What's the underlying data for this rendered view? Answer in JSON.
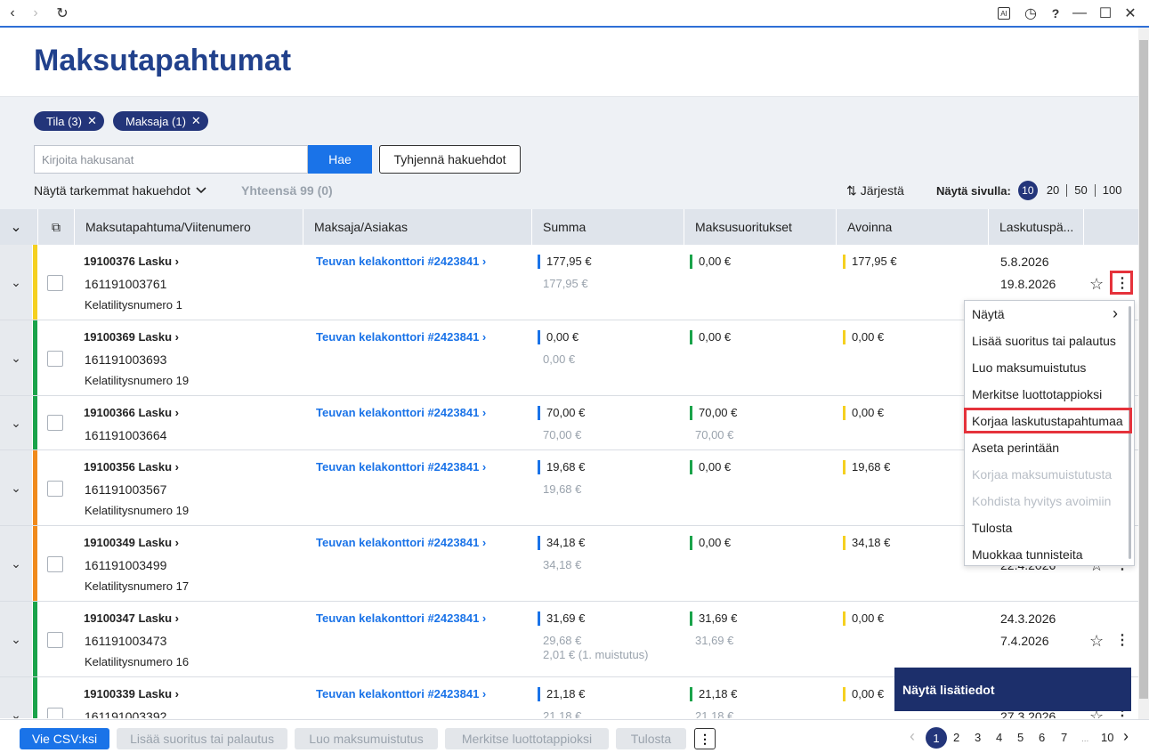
{
  "browser": {
    "back_icon": "‹",
    "forward_icon": "›",
    "reload_icon": "↻",
    "ai_icon": "AI",
    "history_icon": "◷",
    "help_icon": "?",
    "minimize_icon": "—",
    "maximize_icon": "☐",
    "close_icon": "✕"
  },
  "page": {
    "title": "Maksutapahtumat"
  },
  "filters": {
    "chips": [
      {
        "label": "Tila (3)"
      },
      {
        "label": "Maksaja (1)"
      }
    ],
    "chip_close": "✕",
    "search_placeholder": "Kirjoita hakusanat",
    "search_button": "Hae",
    "clear_button": "Tyhjennä hakuehdot",
    "more_filters": "Näytä tarkemmat hakuehdot",
    "total": "Yhteensä 99 (0)",
    "sort": "Järjestä",
    "sort_icon": "⇅",
    "per_page_label": "Näytä sivulla:",
    "per_page_options": [
      "10",
      "20",
      "50",
      "100"
    ]
  },
  "table": {
    "headers": [
      "Maksutapahtuma/Viitenumero",
      "Maksaja/Asiakas",
      "Summa",
      "Maksusuoritukset",
      "Avoinna",
      "Laskutuspä..."
    ],
    "collapse_icon": "⌄",
    "select_all_icon": "⧉",
    "rows": [
      {
        "id": "19100376 Lasku",
        "ref": "161191003761",
        "kela": "Kelatilitysnumero 1",
        "payer": "Teuvan kelakonttori #2423841",
        "summa": "177,95 €",
        "summa2": "177,95 €",
        "suoritus": "0,00 €",
        "suoritus2": "",
        "avoinna": "177,95 €",
        "date1": "5.8.2026",
        "date2": "19.8.2026",
        "status": "#f5d020"
      },
      {
        "id": "19100369 Lasku",
        "ref": "161191003693",
        "kela": "Kelatilitysnumero 19",
        "payer": "Teuvan kelakonttori #2423841",
        "summa": "0,00 €",
        "summa2": "0,00 €",
        "suoritus": "0,00 €",
        "suoritus2": "",
        "avoinna": "0,00 €",
        "date1": "",
        "date2": "",
        "status": "#1aa34a"
      },
      {
        "id": "19100366 Lasku",
        "ref": "161191003664",
        "kela": "",
        "payer": "Teuvan kelakonttori #2423841",
        "summa": "70,00 €",
        "summa2": "70,00 €",
        "suoritus": "70,00 €",
        "suoritus2": "70,00 €",
        "avoinna": "0,00 €",
        "date1": "",
        "date2": "",
        "status": "#1aa34a"
      },
      {
        "id": "19100356 Lasku",
        "ref": "161191003567",
        "kela": "Kelatilitysnumero 19",
        "payer": "Teuvan kelakonttori #2423841",
        "summa": "19,68 €",
        "summa2": "19,68 €",
        "suoritus": "0,00 €",
        "suoritus2": "",
        "avoinna": "19,68 €",
        "date1": "",
        "date2": "",
        "status": "#f08a1c"
      },
      {
        "id": "19100349 Lasku",
        "ref": "161191003499",
        "kela": "Kelatilitysnumero 17",
        "payer": "Teuvan kelakonttori #2423841",
        "summa": "34,18 €",
        "summa2": "34,18 €",
        "suoritus": "0,00 €",
        "suoritus2": "",
        "avoinna": "34,18 €",
        "date1": "",
        "date2": "22.4.2026",
        "status": "#f08a1c"
      },
      {
        "id": "19100347 Lasku",
        "ref": "161191003473",
        "kela": "Kelatilitysnumero 16",
        "payer": "Teuvan kelakonttori #2423841",
        "summa": "31,69 €",
        "summa2": "29,68 €",
        "summa3": "2,01 € (1. muistutus)",
        "suoritus": "31,69 €",
        "suoritus2": "31,69 €",
        "avoinna": "0,00 €",
        "date1": "24.3.2026",
        "date2": "7.4.2026",
        "status": "#1aa34a"
      },
      {
        "id": "19100339 Lasku",
        "ref": "161191003392",
        "kela": "",
        "payer": "Teuvan kelakonttori #2423841",
        "summa": "21,18 €",
        "summa2": "21,18 €",
        "suoritus": "21,18 €",
        "suoritus2": "21,18 €",
        "avoinna": "0,00 €",
        "date1": "",
        "date2": "27.3.2026",
        "status": "#1aa34a"
      }
    ],
    "star_icon": "☆",
    "menu_icon": "⋮",
    "expand_icon": "⌄",
    "link_arrow": "›"
  },
  "context_menu": {
    "items": [
      {
        "label": "Näytä",
        "disabled": false
      },
      {
        "label": "Lisää suoritus tai palautus",
        "disabled": false
      },
      {
        "label": "Luo maksumuistutus",
        "disabled": false
      },
      {
        "label": "Merkitse luottotappioksi",
        "disabled": false
      },
      {
        "label": "Korjaa laskutustapahtumaa",
        "disabled": false
      },
      {
        "label": "Aseta perintään",
        "disabled": false
      },
      {
        "label": "Korjaa maksumuistutusta",
        "disabled": true
      },
      {
        "label": "Kohdista hyvitys avoimiin",
        "disabled": true
      },
      {
        "label": "Tulosta",
        "disabled": false
      },
      {
        "label": "Muokkaa tunnisteita",
        "disabled": false
      }
    ],
    "submenu_icon": "›"
  },
  "more_info": "Näytä lisätiedot",
  "bottom": {
    "csv": "Vie CSV:ksi",
    "actions": [
      "Lisää suoritus tai palautus",
      "Luo maksumuistutus",
      "Merkitse luottotappioksi",
      "Tulosta"
    ],
    "more_icon": "⋮",
    "pages": [
      "1",
      "2",
      "3",
      "4",
      "5",
      "6",
      "7",
      "...",
      "10"
    ],
    "prev_icon": "‹",
    "next_icon": "›"
  },
  "colors": {
    "accent": "#1a73e8",
    "navy": "#23357a",
    "title": "#21418c",
    "summa_bar": "#1a73e8",
    "suoritus_bar": "#1aa34a",
    "avoinna_bar": "#f5d020",
    "highlight": "#e5323b"
  }
}
